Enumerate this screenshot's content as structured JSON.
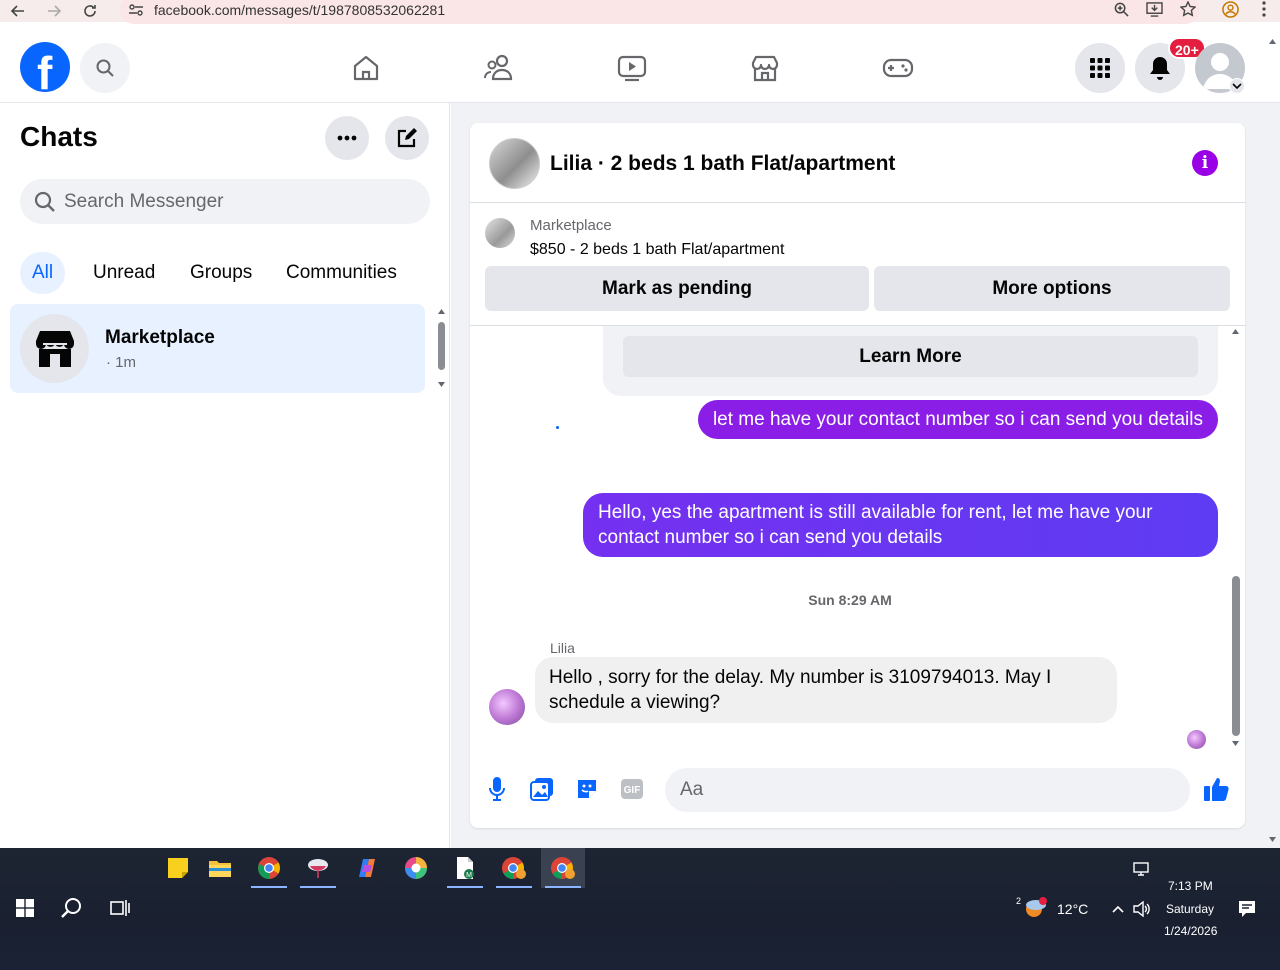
{
  "browser": {
    "url": "facebook.com/messages/t/1987808532062281"
  },
  "header": {
    "notification_badge": "20+"
  },
  "sidebar": {
    "title": "Chats",
    "search_placeholder": "Search Messenger",
    "filters": [
      "All",
      "Unread",
      "Groups",
      "Communities"
    ],
    "active_filter": "All",
    "chats": [
      {
        "name": "Marketplace",
        "time": "· 1m"
      }
    ]
  },
  "conversation": {
    "title": "Lilia · 2 beds 1 bath Flat/apartment",
    "marketplace_label": "Marketplace",
    "listing": "$850 - 2 beds 1 bath Flat/apartment",
    "mark_pending_label": "Mark as pending",
    "more_options_label": "More options",
    "learn_more_label": "Learn More",
    "messages": {
      "out1": "let me have your contact number so i can send you details",
      "out2": "Hello, yes the apartment is still available for rent, let me have your contact number so i can send you details",
      "timestamp": "Sun 8:29 AM",
      "sender": "Lilia",
      "in1": "Hello , sorry for the delay.  My number is 3109794013.  May I schedule a viewing?"
    },
    "composer_placeholder": "Aa",
    "gif_label": "GIF"
  },
  "taskbar": {
    "weather": "12°C",
    "weather_badge": "2",
    "time": "7:13 PM",
    "day": "Saturday",
    "date": "1/24/2026"
  },
  "colors": {
    "fb_blue": "#0866ff",
    "messenger_purple": "#8a1ee6",
    "info_purple": "#9a00e6",
    "notification_red": "#e41e3f"
  }
}
